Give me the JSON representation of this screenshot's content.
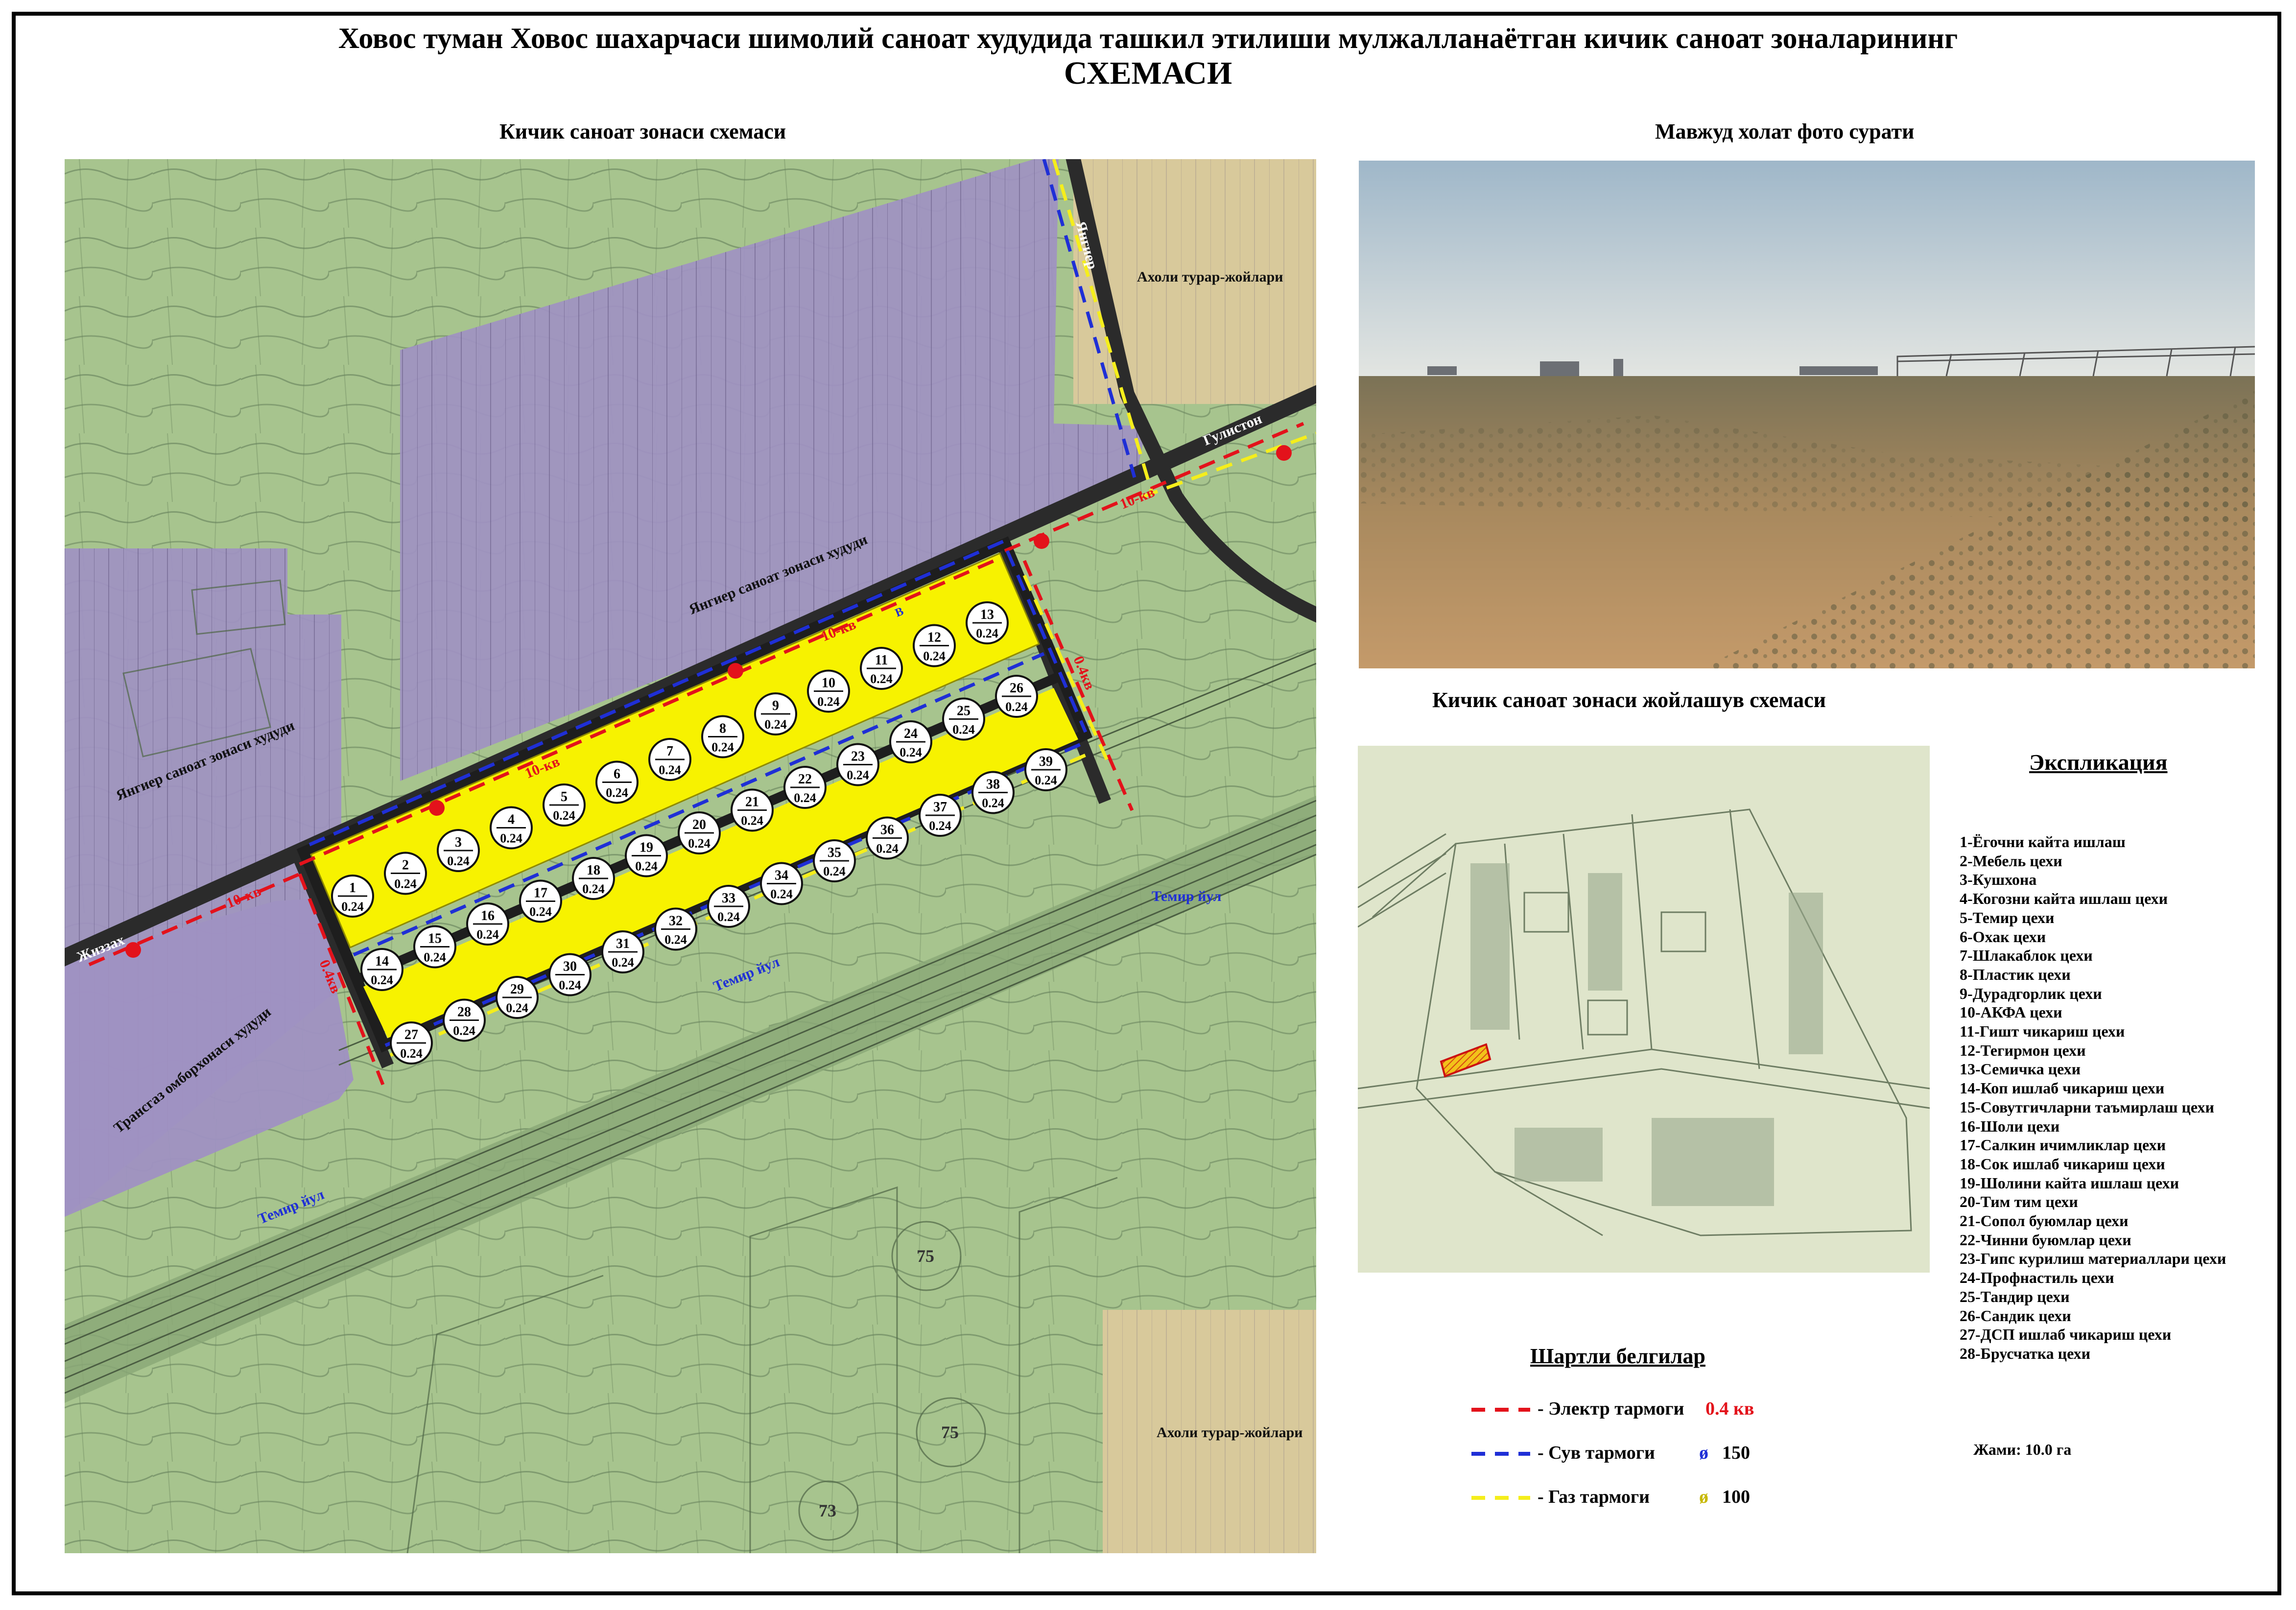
{
  "title_line1": "Ховос туман Ховос шахарчаси шимолий саноат худудида ташкил этилиши мулжалланаётган кичик саноат зоналарининг",
  "title_line2": "СХЕМАСИ",
  "sections": {
    "zone_scheme": "Кичик саноат зонаси схемаси",
    "photo": "Мавжуд холат фото сурати",
    "location_scheme": "Кичик саноат зонаси жойлашув схемаси"
  },
  "map_labels": {
    "yangiyer_industrial_1": "Янгиер саноат зонаси худуди",
    "yangiyer_industrial_2": "Янгиер саноат зонаси худуди",
    "residential_1": "Ахоли турар-жойлари",
    "residential_2": "Ахоли турар-жойлари",
    "transgaz": "Трансгаз омборхонаси худуди",
    "road_yangiyer": "Янгиер",
    "road_gulistan": "Гулистон",
    "road_jizzakh": "Жиззах",
    "railway_1": "Темир йул",
    "railway_2": "Темир йул",
    "railway_3": "Темир йул",
    "line_10kv_1": "10-кв",
    "line_10kv_2": "10-кв",
    "line_10kv_3": "10-кв",
    "line_10kv_4": "10-кв",
    "line_04kv_1": "0.4кв",
    "line_04kv_2": "0.4кв",
    "water_mark": "В",
    "route_75a": "75",
    "route_75b": "75",
    "route_73": "73"
  },
  "plots": [
    {
      "n": "1",
      "area": "0.24"
    },
    {
      "n": "2",
      "area": "0.24"
    },
    {
      "n": "3",
      "area": "0.24"
    },
    {
      "n": "4",
      "area": "0.24"
    },
    {
      "n": "5",
      "area": "0.24"
    },
    {
      "n": "6",
      "area": "0.24"
    },
    {
      "n": "7",
      "area": "0.24"
    },
    {
      "n": "8",
      "area": "0.24"
    },
    {
      "n": "9",
      "area": "0.24"
    },
    {
      "n": "10",
      "area": "0.24"
    },
    {
      "n": "11",
      "area": "0.24"
    },
    {
      "n": "12",
      "area": "0.24"
    },
    {
      "n": "13",
      "area": "0.24"
    },
    {
      "n": "14",
      "area": "0.24"
    },
    {
      "n": "15",
      "area": "0.24"
    },
    {
      "n": "16",
      "area": "0.24"
    },
    {
      "n": "17",
      "area": "0.24"
    },
    {
      "n": "18",
      "area": "0.24"
    },
    {
      "n": "19",
      "area": "0.24"
    },
    {
      "n": "20",
      "area": "0.24"
    },
    {
      "n": "21",
      "area": "0.24"
    },
    {
      "n": "22",
      "area": "0.24"
    },
    {
      "n": "23",
      "area": "0.24"
    },
    {
      "n": "24",
      "area": "0.24"
    },
    {
      "n": "25",
      "area": "0.24"
    },
    {
      "n": "26",
      "area": "0.24"
    },
    {
      "n": "27",
      "area": "0.24"
    },
    {
      "n": "28",
      "area": "0.24"
    },
    {
      "n": "29",
      "area": "0.24"
    },
    {
      "n": "30",
      "area": "0.24"
    },
    {
      "n": "31",
      "area": "0.24"
    },
    {
      "n": "32",
      "area": "0.24"
    },
    {
      "n": "33",
      "area": "0.24"
    },
    {
      "n": "34",
      "area": "0.24"
    },
    {
      "n": "35",
      "area": "0.24"
    },
    {
      "n": "36",
      "area": "0.24"
    },
    {
      "n": "37",
      "area": "0.24"
    },
    {
      "n": "38",
      "area": "0.24"
    },
    {
      "n": "39",
      "area": "0.24"
    }
  ],
  "explication": {
    "title": "Экспликация",
    "items": [
      "1-Ёгочни кайта ишлаш",
      "2-Мебель цехи",
      "3-Кушхона",
      "4-Когозни кайта ишлаш цехи",
      "5-Темир цехи",
      "6-Охак цехи",
      "7-Шлакаблок цехи",
      "8-Пластик цехи",
      "9-Дурадгорлик цехи",
      "10-АКФА цехи",
      "11-Гишт чикариш цехи",
      "12-Тегирмон цехи",
      "13-Семичка цехи",
      "14-Коп ишлаб чикариш цехи",
      "15-Совутгичларни таъмирлаш цехи",
      "16-Шоли цехи",
      "17-Салкин ичимликлар цехи",
      "18-Сок ишлаб чикариш цехи",
      "19-Шолини кайта ишлаш цехи",
      "20-Тим тим цехи",
      "21-Сопол буюмлар  цехи",
      "22-Чинни буюмлар  цехи",
      "23-Гипс курилиш материаллари  цехи",
      "24-Профнастиль цехи",
      "25-Тандир цехи",
      "26-Сандик цехи",
      "27-ДСП ишлаб чикариш цехи",
      "28-Брусчатка цехи"
    ],
    "total": "Жами: 10.0 га"
  },
  "legend": {
    "title": "Шартли белгилар",
    "items": [
      {
        "label": "- Электр тармоги",
        "spec": "0.4 кв",
        "color": "#e3121b",
        "spec_color": "#e3121b",
        "symbol": ""
      },
      {
        "label": "- Сув тармоги",
        "spec": "150",
        "color": "#1f2fd6",
        "spec_color": "#000000",
        "symbol": "ø"
      },
      {
        "label": "- Газ тармоги",
        "spec": "100",
        "color": "#f5ee1b",
        "spec_color": "#000000",
        "symbol": "ø"
      }
    ]
  },
  "colors": {
    "map_green": "#a7c48e",
    "industrial_purple": "#9f91c2",
    "residential_tan": "#d8c99b",
    "plot_yellow": "#f7f200",
    "road": "#2b2b2b",
    "electric": "#e3121b",
    "water": "#1f2fd6",
    "gas": "#f5ee1b"
  }
}
